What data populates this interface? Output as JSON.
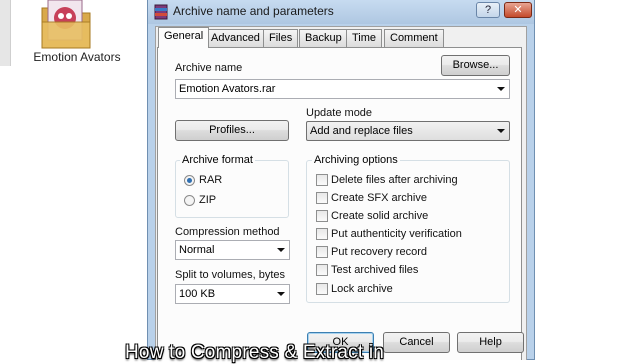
{
  "desktop": {
    "folder_label": "Emotion Avators"
  },
  "dialog": {
    "title": "Archive name and parameters",
    "help_glyph": "?",
    "close_glyph": "✕",
    "tabs": [
      "General",
      "Advanced",
      "Files",
      "Backup",
      "Time",
      "Comment"
    ],
    "active_tab": "General",
    "archive_name_label": "Archive name",
    "browse_label": "Browse...",
    "archive_name_value": "Emotion Avators.rar",
    "profiles_label": "Profiles...",
    "update_mode_label": "Update mode",
    "update_mode_value": "Add and replace files",
    "archive_format_label": "Archive format",
    "formats": [
      {
        "label": "RAR",
        "selected": true
      },
      {
        "label": "ZIP",
        "selected": false
      }
    ],
    "compression_label": "Compression method",
    "compression_value": "Normal",
    "split_label": "Split to volumes, bytes",
    "split_value": "100 KB",
    "archiving_options_label": "Archiving options",
    "options": [
      {
        "label": "Delete files after archiving",
        "checked": false
      },
      {
        "label": "Create SFX archive",
        "checked": false
      },
      {
        "label": "Create solid archive",
        "checked": false
      },
      {
        "label": "Put authenticity verification",
        "checked": false
      },
      {
        "label": "Put recovery record",
        "checked": false
      },
      {
        "label": "Test archived files",
        "checked": false
      },
      {
        "label": "Lock archive",
        "checked": false
      }
    ],
    "ok_label": "OK",
    "cancel_label": "Cancel",
    "help_label": "Help"
  },
  "caption": "How to Compress & Extract in",
  "colors": {
    "title_bar": "#b9d1ea",
    "dialog_body": "#f0f0f0",
    "radio_dot": "#2f6fb1",
    "close_button": "#c44a2b"
  }
}
